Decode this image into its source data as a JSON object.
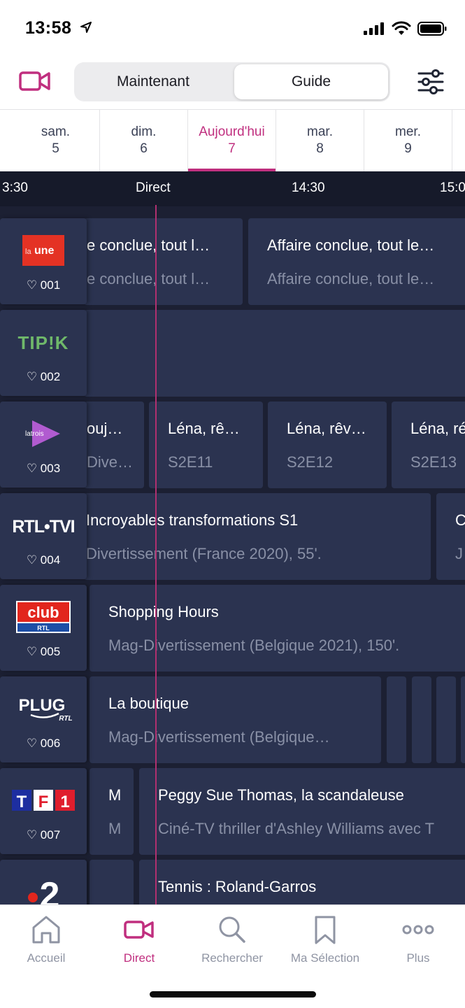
{
  "status_bar": {
    "time": "13:58"
  },
  "header": {
    "segment": {
      "now_label": "Maintenant",
      "guide_label": "Guide",
      "selected": "Guide"
    },
    "icons": {
      "left": "video-camera-icon",
      "right": "filter-sliders-icon"
    }
  },
  "days": [
    {
      "name": "sam.",
      "num": "5"
    },
    {
      "name": "dim.",
      "num": "6"
    },
    {
      "name": "Aujourd'hui",
      "num": "7",
      "active": true
    },
    {
      "name": "mar.",
      "num": "8"
    },
    {
      "name": "mer.",
      "num": "9"
    }
  ],
  "timeline": {
    "left": "3:30",
    "direct": "Direct",
    "mid": "14:30",
    "right": "15:0"
  },
  "channels": [
    {
      "number": "♡ 001",
      "logo_text": "la une"
    },
    {
      "number": "♡ 002",
      "logo_text": "TIP!K"
    },
    {
      "number": "♡ 003",
      "logo_text": "latrois"
    },
    {
      "number": "♡ 004",
      "logo_text": "RTL TVI"
    },
    {
      "number": "♡ 005",
      "logo_text": "club RTL"
    },
    {
      "number": "♡ 006",
      "logo_text": "PLUG RTL"
    },
    {
      "number": "♡ 007",
      "logo_text": "TF1"
    },
    {
      "number": "",
      "logo_text": "2"
    }
  ],
  "programs": {
    "r1": [
      {
        "title": "e conclue, tout l…",
        "sub": "e conclue, tout l…"
      },
      {
        "title": "Affaire conclue, tout le…",
        "sub": "Affaire conclue, tout le…"
      }
    ],
    "r3": [
      {
        "title": "ouj…",
        "sub": "Dive…"
      },
      {
        "title": "Léna, rê…",
        "sub": "S2E11"
      },
      {
        "title": "Léna, rêv…",
        "sub": "S2E12"
      },
      {
        "title": "Léna, ré",
        "sub": "S2E13"
      }
    ],
    "r4": [
      {
        "title": "Incroyables transformations S1",
        "sub": "Divertissement (France 2020), 55'."
      },
      {
        "title": "C",
        "sub": "J"
      }
    ],
    "r5": [
      {
        "title": "Shopping Hours",
        "sub": "Mag-Divertissement (Belgique 2021), 150'."
      }
    ],
    "r6": [
      {
        "title": "La boutique",
        "sub": "Mag-Divertissement (Belgique…"
      }
    ],
    "r7": [
      {
        "title": "M",
        "sub": "M"
      },
      {
        "title": "Peggy Sue Thomas, la scandaleuse",
        "sub": "Ciné-TV thriller d'Ashley Williams avec T"
      }
    ],
    "r8": [
      {
        "title": "Tennis : Roland-Garros",
        "sub": ""
      }
    ]
  },
  "tabs": [
    {
      "label": "Accueil",
      "icon": "home-icon"
    },
    {
      "label": "Direct",
      "icon": "video-camera-icon",
      "active": true
    },
    {
      "label": "Rechercher",
      "icon": "search-icon"
    },
    {
      "label": "Ma Sélection",
      "icon": "bookmark-icon"
    },
    {
      "label": "Plus",
      "icon": "more-dots-icon"
    }
  ],
  "colors": {
    "accent": "#c02f7f",
    "guide_bg": "#1c2033",
    "cell_bg": "#2b3350",
    "timeline_bg": "#161a2a"
  }
}
